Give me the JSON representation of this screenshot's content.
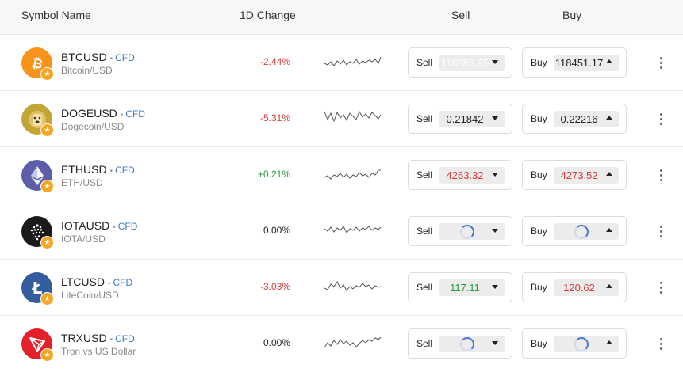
{
  "header": {
    "symbol_name": "Symbol Name",
    "change": "1D Change",
    "sell": "Sell",
    "buy": "Buy"
  },
  "rows": [
    {
      "symbol": "BTCUSD",
      "tag": "CFD",
      "desc": "Bitcoin/USD",
      "change": "-2.44%",
      "change_dir": "neg",
      "sell_label": "Sell",
      "sell_price": "118285.95",
      "sell_style": "ghost",
      "sell_loading": false,
      "buy_label": "Buy",
      "buy_price": "118451.17",
      "buy_style": "normal",
      "buy_loading": false,
      "icon": "bitcoin-icon",
      "icon_color": "#f7931a"
    },
    {
      "symbol": "DOGEUSD",
      "tag": "CFD",
      "desc": "Dogecoin/USD",
      "change": "-5.31%",
      "change_dir": "neg",
      "sell_label": "Sell",
      "sell_price": "0.21842",
      "sell_style": "normal",
      "sell_loading": false,
      "buy_label": "Buy",
      "buy_price": "0.22216",
      "buy_style": "normal",
      "buy_loading": false,
      "icon": "dogecoin-icon",
      "icon_color": "#c2a633"
    },
    {
      "symbol": "ETHUSD",
      "tag": "CFD",
      "desc": "ETH/USD",
      "change": "+0.21%",
      "change_dir": "pos",
      "sell_label": "Sell",
      "sell_price": "4263.32",
      "sell_style": "red",
      "sell_loading": false,
      "buy_label": "Buy",
      "buy_price": "4273.52",
      "buy_style": "red",
      "buy_loading": false,
      "icon": "ethereum-icon",
      "icon_color": "#5c5fa8"
    },
    {
      "symbol": "IOTAUSD",
      "tag": "CFD",
      "desc": "IOTA/USD",
      "change": "0.00%",
      "change_dir": "neu",
      "sell_label": "Sell",
      "sell_price": "",
      "sell_style": "normal",
      "sell_loading": true,
      "buy_label": "Buy",
      "buy_price": "",
      "buy_style": "normal",
      "buy_loading": true,
      "icon": "iota-icon",
      "icon_color": "#1a1a1a"
    },
    {
      "symbol": "LTCUSD",
      "tag": "CFD",
      "desc": "LiteCoin/USD",
      "change": "-3.03%",
      "change_dir": "neg",
      "sell_label": "Sell",
      "sell_price": "117.11",
      "sell_style": "green",
      "sell_loading": false,
      "buy_label": "Buy",
      "buy_price": "120.62",
      "buy_style": "red",
      "buy_loading": false,
      "icon": "litecoin-icon",
      "icon_color": "#345d9d"
    },
    {
      "symbol": "TRXUSD",
      "tag": "CFD",
      "desc": "Tron vs US Dollar",
      "change": "0.00%",
      "change_dir": "neu",
      "sell_label": "Sell",
      "sell_price": "",
      "sell_style": "normal",
      "sell_loading": true,
      "buy_label": "Buy",
      "buy_price": "",
      "buy_style": "normal",
      "buy_loading": true,
      "icon": "tron-icon",
      "icon_color": "#e5202b"
    }
  ]
}
